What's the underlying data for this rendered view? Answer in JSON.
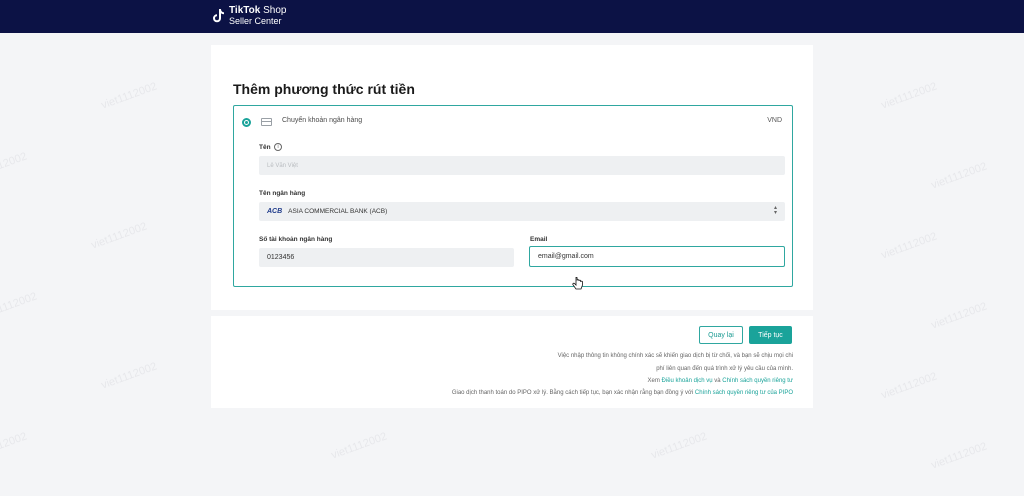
{
  "brand": {
    "name_bold": "TikTok",
    "name_light": " Shop",
    "sub": "Seller Center"
  },
  "page": {
    "title": "Thêm phương thức rút tiền"
  },
  "method": {
    "label": "Chuyển khoản ngân hàng",
    "currency": "VND"
  },
  "form": {
    "name_label": "Tên",
    "name_value": "Lê Văn Việt",
    "bank_label": "Tên ngân hàng",
    "bank_abbr": "ACB",
    "bank_value": "ASIA COMMERCIAL BANK (ACB)",
    "account_label": "Số tài khoản ngân hàng",
    "account_value": "0123456",
    "email_label": "Email",
    "email_value": "email@gmail.com"
  },
  "actions": {
    "back_label": "Quay lại",
    "next_label": "Tiếp tục"
  },
  "legal": {
    "line1": "Việc nhập thông tin không chính xác sẽ khiến giao dịch bị từ chối, và bạn sẽ chịu mọi chi",
    "line2": "phí liên quan đến quá trình xử lý yêu cầu của mình.",
    "line3_pre": "Xem ",
    "line3_link1": "Điều khoản dịch vụ",
    "line3_mid": " và ",
    "line3_link2": "Chính sách quyền riêng tư",
    "line4_pre": "Giao dịch thanh toán do PIPO xử lý. Bằng cách tiếp tục, bạn xác nhận rằng bạn đồng ý với ",
    "line4_link": "Chính sách quyền riêng tư của PIPO"
  },
  "watermark": "viet1112002"
}
